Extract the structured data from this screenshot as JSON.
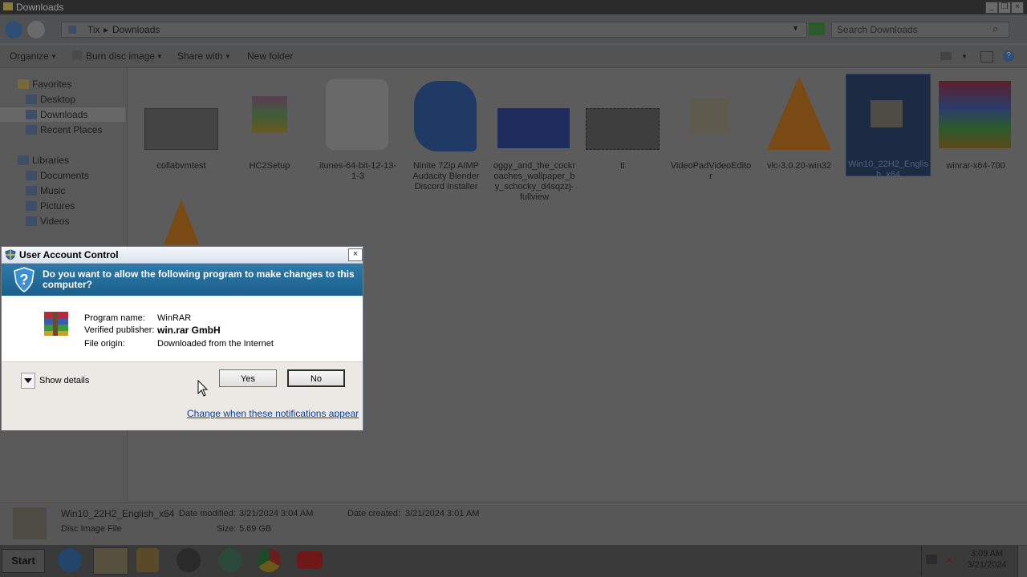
{
  "explorer": {
    "title": "Downloads",
    "breadcrumb": [
      "Tix",
      "Downloads"
    ],
    "search_placeholder": "Search Downloads",
    "toolbar": {
      "organize": "Organize",
      "burn": "Burn disc image",
      "share": "Share with",
      "new_folder": "New folder"
    },
    "nav": {
      "favorites": "Favorites",
      "desktop": "Desktop",
      "downloads": "Downloads",
      "recent": "Recent Places",
      "libraries": "Libraries",
      "documents": "Documents",
      "music": "Music",
      "pictures": "Pictures",
      "videos": "Videos"
    },
    "files": [
      {
        "label": "collabvmtest"
      },
      {
        "label": "HC2Setup"
      },
      {
        "label": "itunes-64-bit-12-13-1-3"
      },
      {
        "label": "Ninite 7Zip AIMP Audacity Blender Discord Installer"
      },
      {
        "label": "oggy_and_the_cockroaches_wallpaper_by_schocky_d4sqzzj-fullview"
      },
      {
        "label": "ti"
      },
      {
        "label": "VideoPadVideoEditor"
      },
      {
        "label": "vlc-3.0.20-win32"
      },
      {
        "label": "Win10_22H2_English_x64"
      },
      {
        "label": "winrar-x64-700"
      }
    ],
    "details": {
      "name": "Win10_22H2_English_x64",
      "modified_label": "Date modified:",
      "modified": "3/21/2024 3:04 AM",
      "created_label": "Date created:",
      "created": "3/21/2024 3:01 AM",
      "type": "Disc Image File",
      "size_label": "Size:",
      "size": "5.69 GB"
    }
  },
  "uac": {
    "title": "User Account Control",
    "question": "Do you want to allow the following program to make changes to this computer?",
    "program_label": "Program name:",
    "program": "WinRAR",
    "publisher_label": "Verified publisher:",
    "publisher": "win.rar GmbH",
    "origin_label": "File origin:",
    "origin": "Downloaded from the Internet",
    "show_details": "Show details",
    "yes": "Yes",
    "no": "No",
    "change_link": "Change when these notifications appear"
  },
  "taskbar": {
    "start": "Start",
    "time": "3:09 AM",
    "date": "3/21/2024"
  }
}
